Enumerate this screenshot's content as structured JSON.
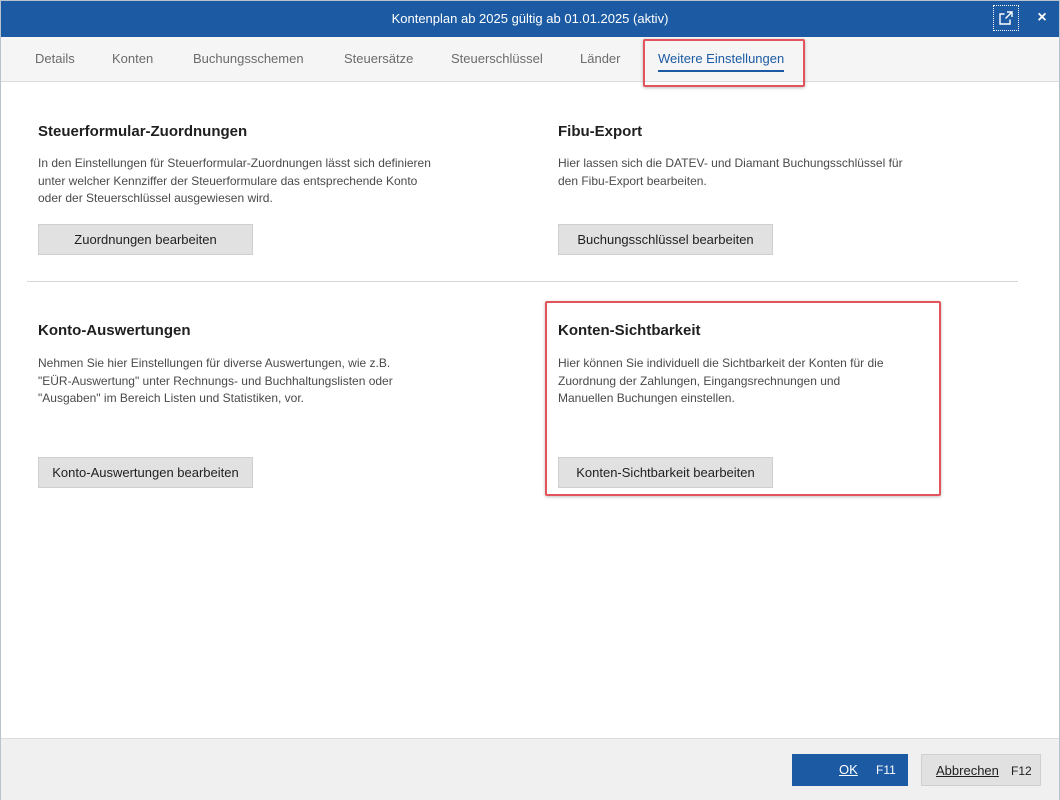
{
  "window": {
    "title": "Kontenplan ab 2025 gültig ab 01.01.2025 (aktiv)",
    "popout_icon": "external-link-icon",
    "close_icon": "×"
  },
  "tabs": [
    {
      "label": "Details",
      "active": false
    },
    {
      "label": "Konten",
      "active": false
    },
    {
      "label": "Buchungsschemen",
      "active": false
    },
    {
      "label": "Steuersätze",
      "active": false
    },
    {
      "label": "Steuerschlüssel",
      "active": false
    },
    {
      "label": "Länder",
      "active": false
    },
    {
      "label": "Weitere Einstellungen",
      "active": true
    }
  ],
  "sections": {
    "steuerformular": {
      "title": "Steuerformular-Zuordnungen",
      "description": "In den Einstellungen für Steuerformular-Zuordnungen lässt sich definieren\nunter welcher Kennziffer der Steuerformulare das entsprechende Konto\noder der Steuerschlüssel ausgewiesen wird.",
      "button": "Zuordnungen bearbeiten"
    },
    "fibu": {
      "title": "Fibu-Export",
      "description": "Hier lassen sich die DATEV- und Diamant Buchungsschlüssel für\nden Fibu-Export bearbeiten.",
      "button": "Buchungsschlüssel bearbeiten"
    },
    "auswertungen": {
      "title": "Konto-Auswertungen",
      "description": "Nehmen Sie hier Einstellungen für diverse Auswertungen, wie z.B.\n\"EÜR-Auswertung\" unter Rechnungs- und Buchhaltungslisten oder\n\"Ausgaben\" im Bereich Listen und Statistiken, vor.",
      "button": "Konto-Auswertungen bearbeiten"
    },
    "sichtbarkeit": {
      "title": "Konten-Sichtbarkeit",
      "description": "Hier können Sie individuell die Sichtbarkeit der Konten für die\nZuordnung  der Zahlungen,  Eingangsrechnungen und\nManuellen Buchungen einstellen.",
      "button": "Konten-Sichtbarkeit bearbeiten"
    }
  },
  "footer": {
    "ok_label": "OK",
    "ok_key": "F11",
    "cancel_label": "Abbrechen",
    "cancel_key": "F12"
  },
  "colors": {
    "accent": "#1c5ba3",
    "highlight": "#e2545c"
  }
}
